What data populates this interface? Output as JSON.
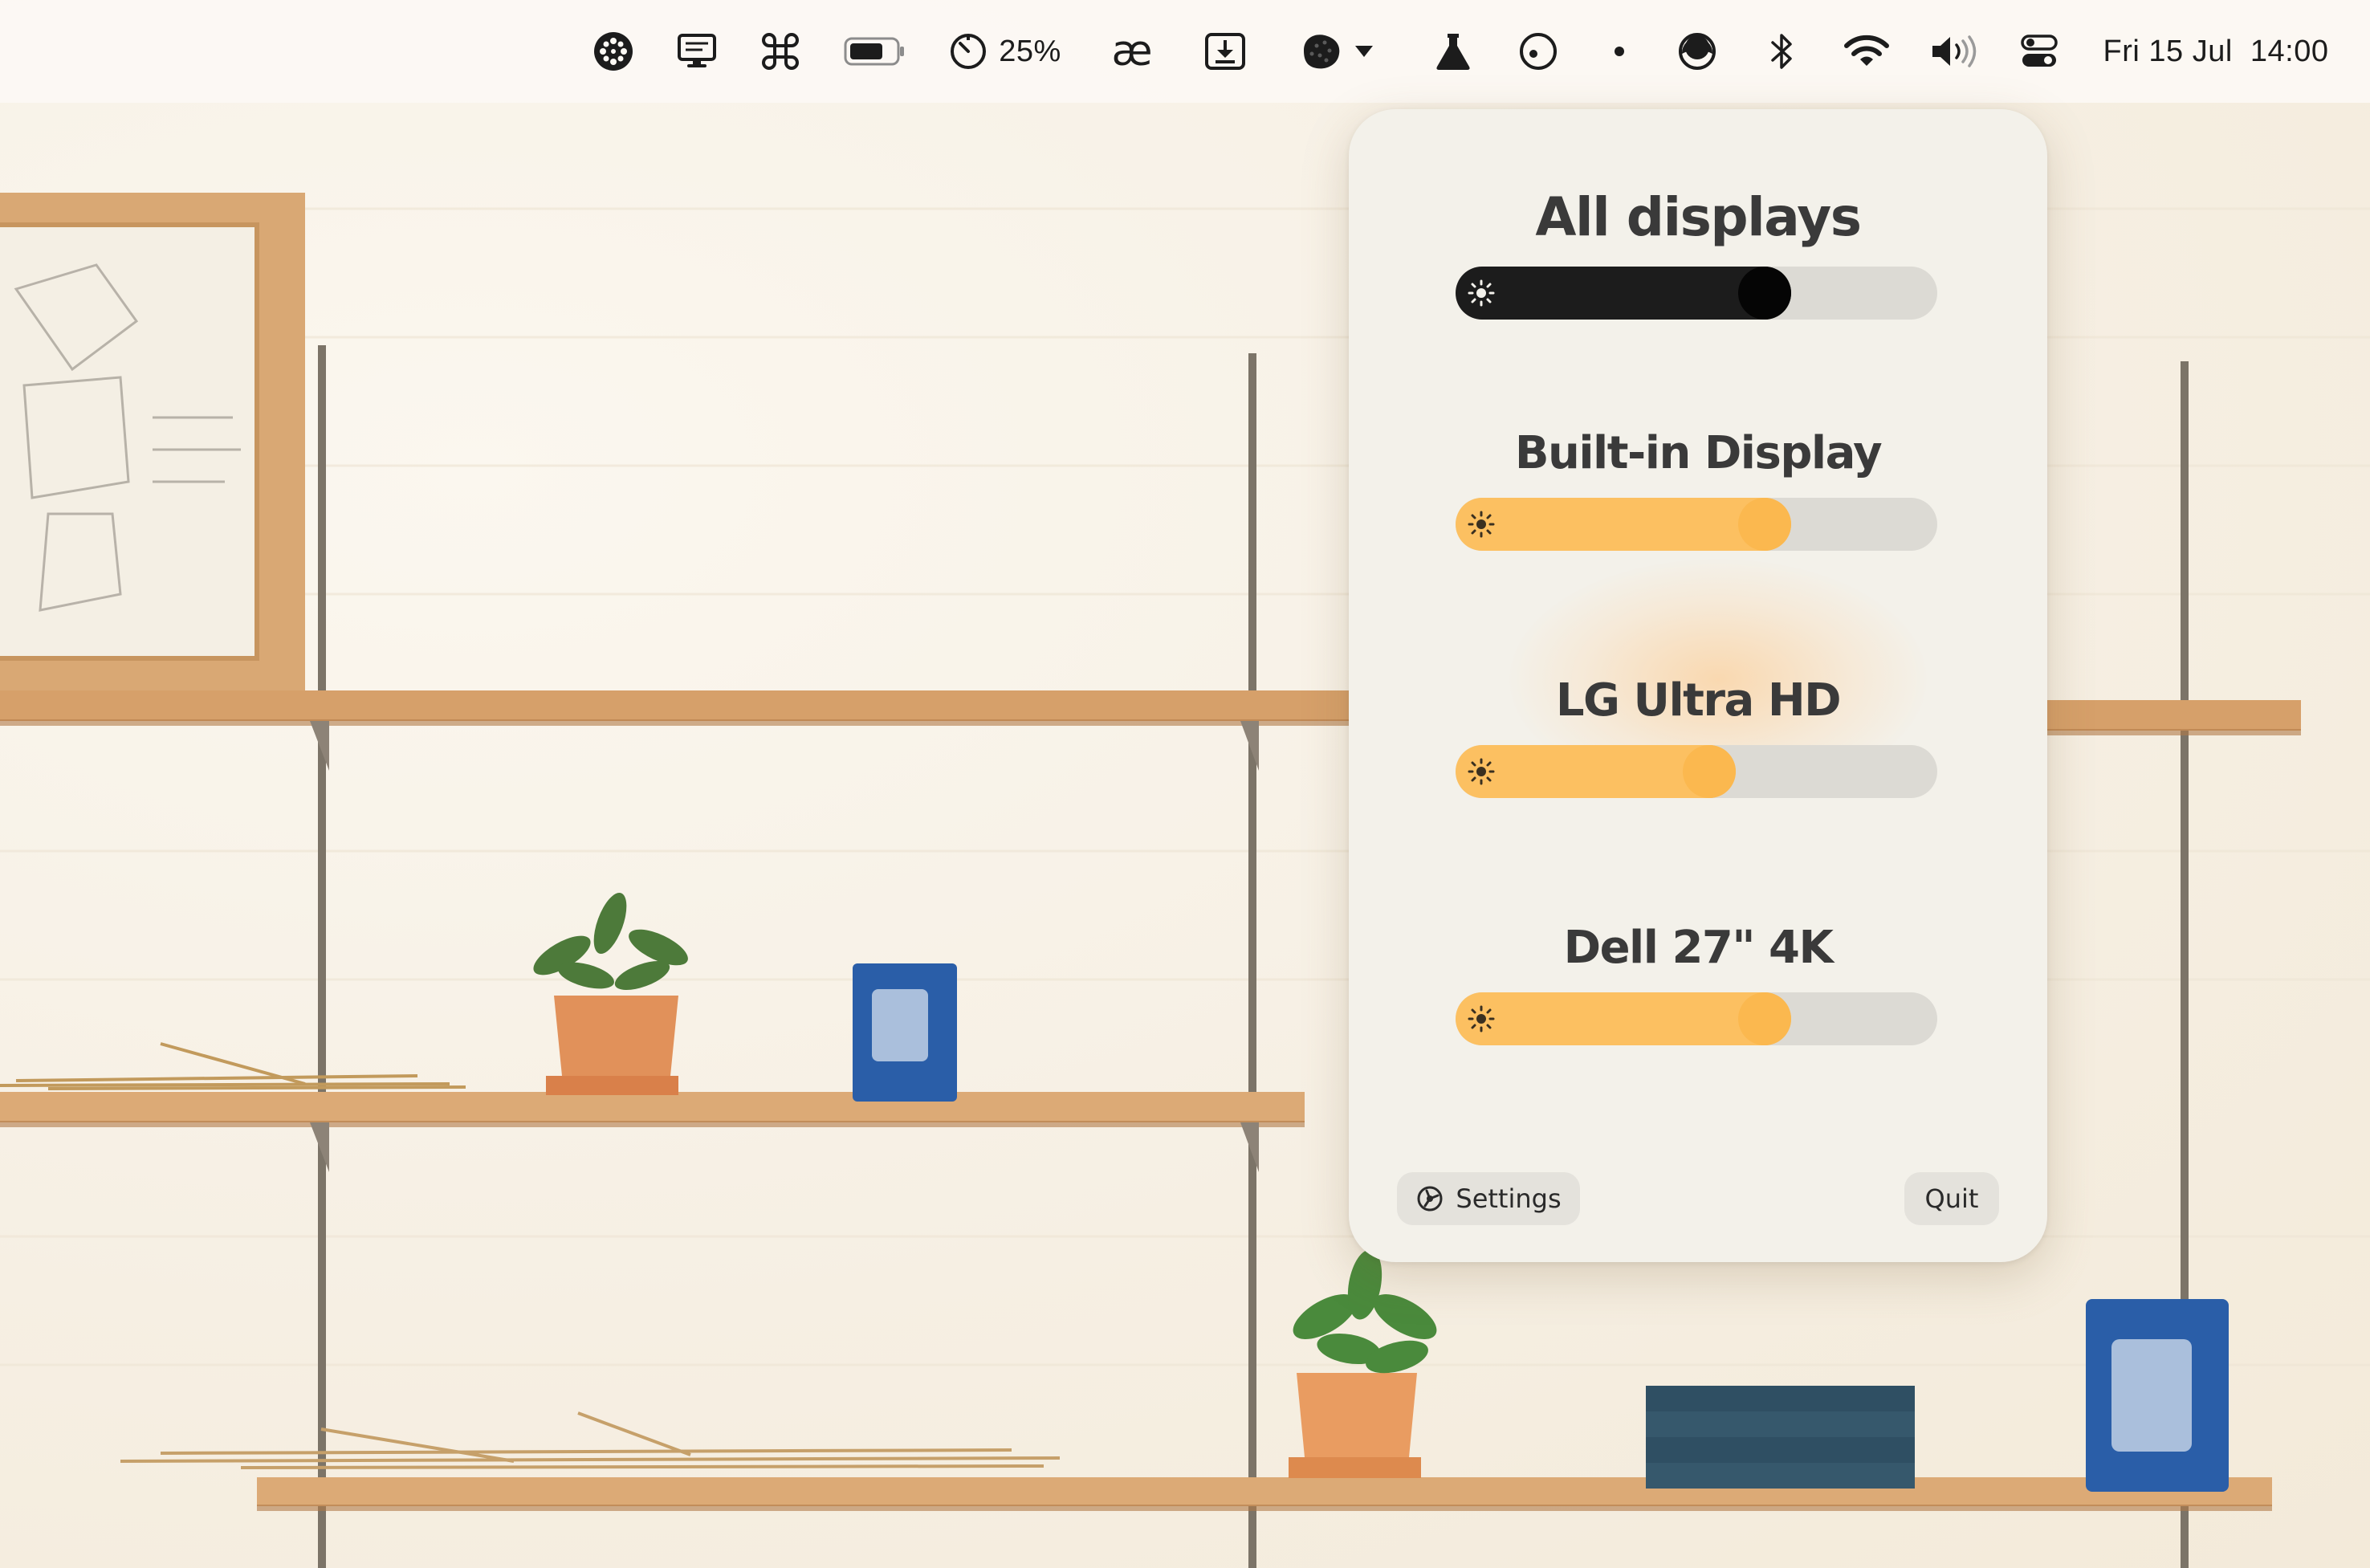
{
  "menubar": {
    "items": [
      {
        "icon": "dotted-circle-icon"
      },
      {
        "icon": "display-monitor-icon"
      },
      {
        "icon": "command-key-icon"
      },
      {
        "icon": "battery-icon"
      },
      {
        "icon": "timer-icon",
        "label": "25%"
      },
      {
        "icon": "ae-ligature-icon",
        "label": "æ"
      },
      {
        "icon": "download-tray-icon"
      },
      {
        "icon": "dark-blob-dropdown-icon"
      },
      {
        "icon": "flask-icon"
      },
      {
        "icon": "face-circle-icon"
      },
      {
        "icon": "dot-icon"
      },
      {
        "icon": "half-moon-circle-icon"
      },
      {
        "icon": "bluetooth-icon"
      },
      {
        "icon": "wifi-icon"
      },
      {
        "icon": "volume-icon"
      },
      {
        "icon": "control-center-icon"
      }
    ],
    "clock": "Fri 15 Jul  14:00"
  },
  "panel": {
    "displays": [
      {
        "name": "All displays",
        "brightness": 0.66,
        "style": "master"
      },
      {
        "name": "Built-in Display",
        "brightness": 0.66,
        "style": "warm"
      },
      {
        "name": "LG Ultra HD",
        "brightness": 0.53,
        "style": "warm"
      },
      {
        "name": "Dell 27\" 4K",
        "brightness": 0.66,
        "style": "warm"
      }
    ],
    "settings_label": "Settings",
    "quit_label": "Quit"
  },
  "colors": {
    "master_fill": "#1c1c1c",
    "master_knob": "#050505",
    "warm_fill": "#fcc061",
    "warm_knob": "#fbb84f",
    "track": "#dcdad4"
  }
}
